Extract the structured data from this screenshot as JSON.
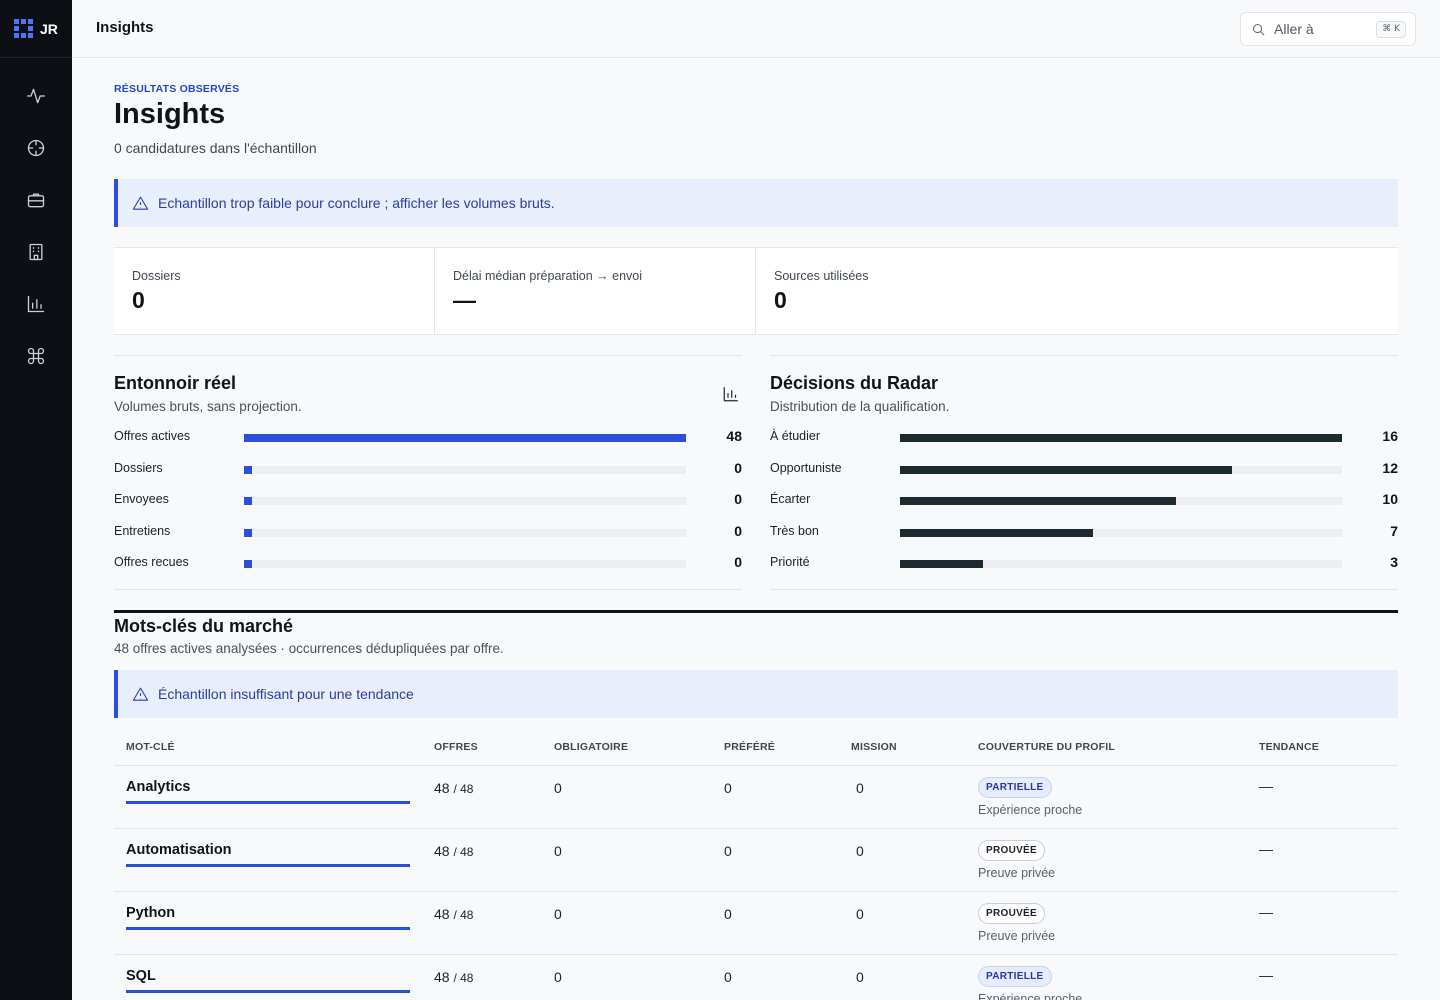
{
  "app": {
    "logo_text": "JR"
  },
  "topbar": {
    "title": "Insights",
    "search_placeholder": "Aller à",
    "search_shortcut": "⌘ K"
  },
  "sidebar": {
    "items": [
      {
        "icon": "activity-icon"
      },
      {
        "icon": "crosshair-icon"
      },
      {
        "icon": "briefcase-icon"
      },
      {
        "icon": "building-icon"
      },
      {
        "icon": "bar-chart-icon"
      },
      {
        "icon": "command-icon"
      }
    ]
  },
  "header": {
    "eyebrow": "RÉSULTATS OBSERVÉS",
    "title": "Insights",
    "subtitle": "0 candidatures dans l'échantillon"
  },
  "alerts": {
    "sample": "Echantillon trop faible pour conclure ; afficher les volumes bruts.",
    "trend": "Échantillon insuffisant pour une tendance"
  },
  "stats": [
    {
      "label": "Dossiers",
      "value": "0"
    },
    {
      "label": "Délai médian préparation → envoi",
      "value": "—"
    },
    {
      "label": "Sources utilisées",
      "value": "0"
    }
  ],
  "funnel": {
    "title": "Entonnoir réel",
    "subtitle": "Volumes bruts, sans projection.",
    "color": "#2a4fd8",
    "rows": [
      {
        "label": "Offres actives",
        "value": "48",
        "fraction": 1.0
      },
      {
        "label": "Dossiers",
        "value": "0",
        "fraction": 0.0
      },
      {
        "label": "Envoyees",
        "value": "0",
        "fraction": 0.0
      },
      {
        "label": "Entretiens",
        "value": "0",
        "fraction": 0.0
      },
      {
        "label": "Offres recues",
        "value": "0",
        "fraction": 0.0
      }
    ]
  },
  "radar": {
    "title": "Décisions du Radar",
    "subtitle": "Distribution de la qualification.",
    "color": "#1e2a30",
    "rows": [
      {
        "label": "À étudier",
        "value": "16",
        "fraction": 1.0
      },
      {
        "label": "Opportuniste",
        "value": "12",
        "fraction": 0.75
      },
      {
        "label": "Écarter",
        "value": "10",
        "fraction": 0.625
      },
      {
        "label": "Très bon",
        "value": "7",
        "fraction": 0.4375
      },
      {
        "label": "Priorité",
        "value": "3",
        "fraction": 0.1875
      }
    ]
  },
  "keywords": {
    "title": "Mots-clés du marché",
    "subtitle": "48 offres actives analysées · occurrences dédupliquées par offre.",
    "columns": [
      "MOT-CLÉ",
      "OFFRES",
      "OBLIGATOIRE",
      "PRÉFÉRÉ",
      "MISSION",
      "COUVERTURE DU PROFIL",
      "TENDANCE"
    ],
    "rows": [
      {
        "keyword": "Analytics",
        "offers": "48",
        "offers_total": "/ 48",
        "required": "0",
        "preferred": "0",
        "mission": "0",
        "coverage": "PARTIELLE",
        "coverage_kind": "partial",
        "coverage_note": "Expérience proche",
        "trend": "—"
      },
      {
        "keyword": "Automatisation",
        "offers": "48",
        "offers_total": "/ 48",
        "required": "0",
        "preferred": "0",
        "mission": "0",
        "coverage": "PROUVÉE",
        "coverage_kind": "proven",
        "coverage_note": "Preuve privée",
        "trend": "—"
      },
      {
        "keyword": "Python",
        "offers": "48",
        "offers_total": "/ 48",
        "required": "0",
        "preferred": "0",
        "mission": "0",
        "coverage": "PROUVÉE",
        "coverage_kind": "proven",
        "coverage_note": "Preuve privée",
        "trend": "—"
      },
      {
        "keyword": "SQL",
        "offers": "48",
        "offers_total": "/ 48",
        "required": "0",
        "preferred": "0",
        "mission": "0",
        "coverage": "PARTIELLE",
        "coverage_kind": "partial",
        "coverage_note": "Expérience proche",
        "trend": "—"
      }
    ]
  }
}
